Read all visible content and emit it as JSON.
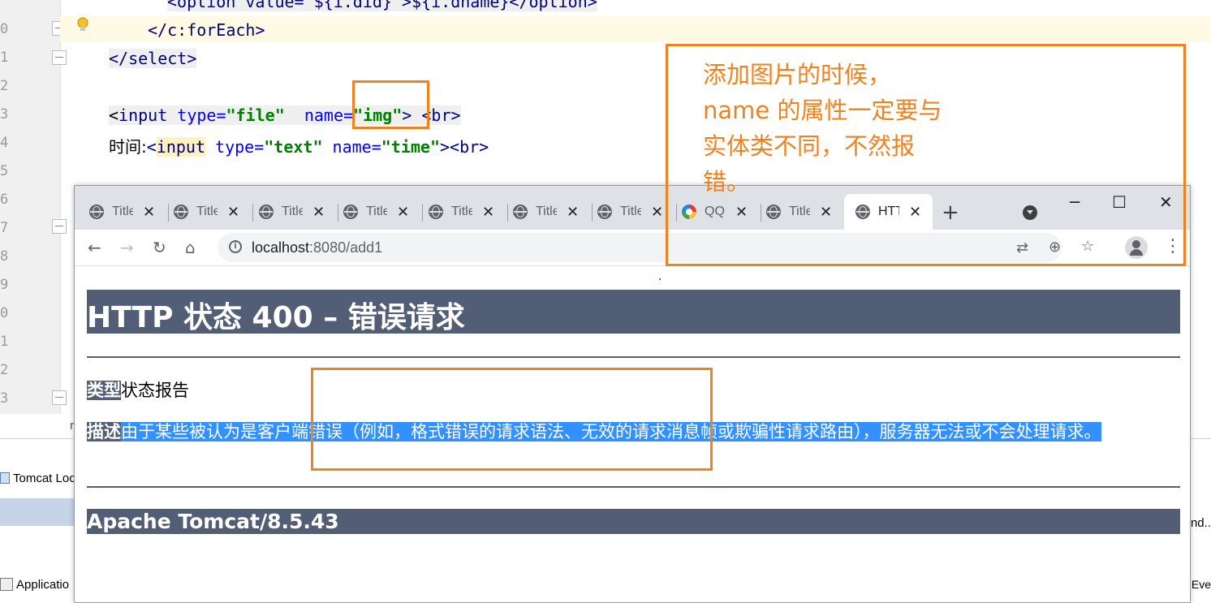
{
  "ide": {
    "line_numbers": [
      "0",
      "1",
      "2",
      "3",
      "4",
      "5",
      "6",
      "7",
      "8",
      "9",
      "0",
      "1",
      "2",
      "3"
    ],
    "code": {
      "line_option": "<option value=\"${i.did}\">${i.dname}</option>",
      "line_foreach": "</c:forEach>",
      "line_select": "</select>",
      "line_input_file_open": "<",
      "line_input_file_tag": "input",
      "line_input_file_type_attr": " type=",
      "line_input_file_type_val": "\"file\"",
      "line_input_file_name_attr": "  name=",
      "line_input_file_name_val": "\"img\"",
      "line_input_file_end": "> <br>",
      "line_time_label": "时间:",
      "line_time_lt": "<",
      "line_time_tag": "input",
      "line_time_type_attr": " type=",
      "line_time_type_val": "\"text\"",
      "line_time_name_attr": " name=",
      "line_time_name_val": "\"time\"",
      "line_time_end": "><br>"
    },
    "bottom": {
      "tomcat_tab": "Tomcat Loc",
      "application_tab": "Applicatio",
      "right_fragment": "nd..",
      "right_events": "Eve",
      "left_fragment": "r"
    }
  },
  "browser": {
    "tabs": [
      {
        "title": "Title",
        "icon": "globe-icon"
      },
      {
        "title": "Title",
        "icon": "globe-icon"
      },
      {
        "title": "Title",
        "icon": "globe-icon"
      },
      {
        "title": "Title",
        "icon": "globe-icon"
      },
      {
        "title": "Title",
        "icon": "globe-icon"
      },
      {
        "title": "Title",
        "icon": "globe-icon"
      },
      {
        "title": "Title",
        "icon": "globe-icon"
      },
      {
        "title": "QQ",
        "icon": "qq-browser-icon"
      },
      {
        "title": "Title",
        "icon": "globe-icon"
      },
      {
        "title": "HTTP",
        "icon": "globe-icon",
        "active": true
      }
    ],
    "close_glyph": "✕",
    "new_tab_glyph": "+",
    "url_host": "localhost",
    "url_rest": ":8080/add1",
    "window_controls": {
      "minimize": "─",
      "maximize": "☐",
      "close": "✕"
    }
  },
  "page": {
    "h1": "HTTP 状态 400 – 错误请求",
    "type_label": "类型",
    "type_value": "状态报告",
    "desc_label": "描述",
    "desc_text": "由于某些被认为是客户端错误（例如，格式错误的请求语法、无效的请求消息帧或欺骗性请求路由），服务器无法或不会处理请求。",
    "footer": "Apache Tomcat/8.5.43"
  },
  "annotation": {
    "note": "添加图片的时候，\nname 的属性一定要与\n实体类不同，不然报\n错。",
    "color": "#f0821e"
  }
}
